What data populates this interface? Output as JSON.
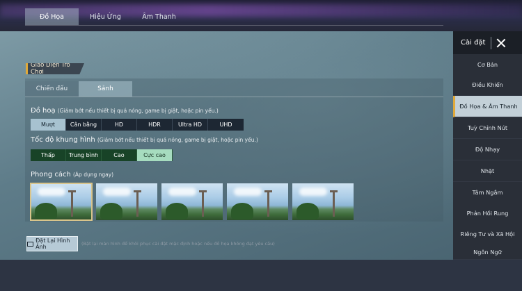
{
  "top_tabs": [
    {
      "label": "Đồ Họa",
      "active": true
    },
    {
      "label": "Hiệu Ứng",
      "active": false
    },
    {
      "label": "Âm Thanh",
      "active": false
    }
  ],
  "section_label": "Giao Diện Trò Chơi",
  "sub_tabs": [
    {
      "label": "Chiến đấu",
      "active": false
    },
    {
      "label": "Sảnh",
      "active": true
    }
  ],
  "graphics": {
    "title": "Đồ hoạ",
    "note": "(Giảm bớt nếu thiết bị quá nóng, game bị giật, hoặc pin yếu.)",
    "options": [
      "Mượt",
      "Cân bằng",
      "HD",
      "HDR",
      "Ultra HD",
      "UHD"
    ],
    "selected": "Mượt"
  },
  "framerate": {
    "title": "Tốc độ khung hình",
    "note": "(Giảm bớt nếu thiết bị quá nóng, game bị giật, hoặc pin yếu.)",
    "options": [
      "Thấp",
      "Trung bình",
      "Cao",
      "Cực cao"
    ],
    "selected": "Cực cao"
  },
  "style": {
    "title": "Phong cách",
    "note": "(Áp dụng ngay)",
    "thumbnails": 5,
    "selected_index": 0
  },
  "reset": {
    "label": "Đặt Lại Hình Ảnh",
    "note": "(Bật lại màn hình để khôi phục cài đặt mặc định hoặc nếu đồ họa không đạt yêu cầu)"
  },
  "sidebar": {
    "title": "Cài đặt",
    "items": [
      {
        "label": "Cơ Bản",
        "active": false
      },
      {
        "label": "Điều Khiển",
        "active": false
      },
      {
        "label": "Đồ Họa & Âm Thanh",
        "active": true
      },
      {
        "label": "Tuỳ Chỉnh Nút",
        "active": false
      },
      {
        "label": "Độ Nhạy",
        "active": false
      },
      {
        "label": "Nhặt",
        "active": false
      },
      {
        "label": "Tâm Ngắm",
        "active": false
      },
      {
        "label": "Phản Hồi Rung",
        "active": false
      },
      {
        "label": "Riêng Tư và Xã Hội",
        "active": false
      },
      {
        "label": "Ngôn Ngữ",
        "active": false
      }
    ]
  },
  "colors": {
    "accent": "#e0a93a",
    "selected_option": "#a7c2d0",
    "selected_fps": "#a6dcbf"
  }
}
